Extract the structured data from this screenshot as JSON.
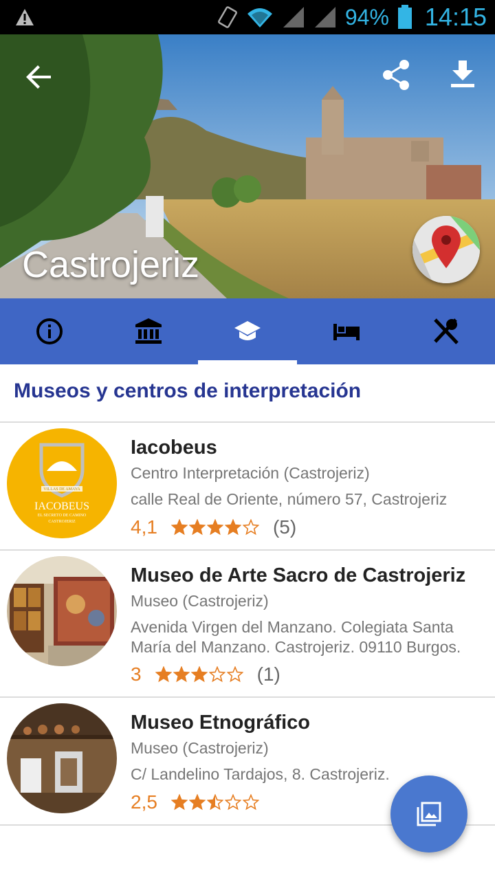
{
  "status_bar": {
    "battery": "94%",
    "time": "14:15"
  },
  "header": {
    "title": "Castrojeriz"
  },
  "tabs": [
    {
      "icon": "info-icon",
      "active": false
    },
    {
      "icon": "museum-icon",
      "active": false
    },
    {
      "icon": "school-icon",
      "active": true
    },
    {
      "icon": "bed-icon",
      "active": false
    },
    {
      "icon": "restaurant-icon",
      "active": false
    }
  ],
  "section": {
    "title": "Museos y centros de interpretación"
  },
  "items": [
    {
      "name": "Iacobeus",
      "type": "Centro Interpretación (Castrojeriz)",
      "address": "calle Real de Oriente, número 57, Castrojeriz",
      "score": "4,1",
      "rating": 4.1,
      "count": "(5)",
      "logo_text": "IACOBEUS",
      "logo_sub": "EL SECRETO DE CAMINO",
      "logo_town": "CASTROJERIZ",
      "logo_banner": "VILLAS DE AMAYA"
    },
    {
      "name": "Museo de Arte Sacro de Castrojeriz",
      "type": "Museo (Castrojeriz)",
      "address": "Avenida Virgen del Manzano. Colegiata Santa María del Manzano. Castrojeriz. 09110 Burgos.",
      "score": "3",
      "rating": 3,
      "count": "(1)"
    },
    {
      "name": "Museo Etnográfico",
      "type": "Museo (Castrojeriz)",
      "address": "C/ Landelino Tardajos, 8. Castrojeriz.",
      "score": "2,5",
      "rating": 2.5,
      "count": ""
    }
  ],
  "colors": {
    "accent": "#3f66c5",
    "rating": "#e67e22",
    "section_title": "#263591",
    "fab": "#4a78cf"
  }
}
